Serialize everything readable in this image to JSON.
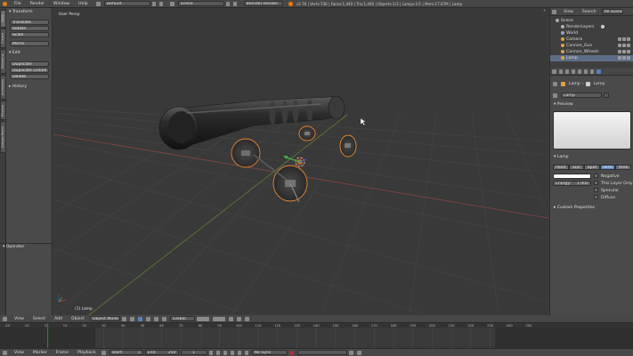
{
  "colors": {
    "accent": "#5680c2",
    "selection_orange": "#e8892c",
    "grid": "#4a4a4a",
    "axis_x": "#9a4b4b",
    "axis_y": "#6b8f3e",
    "current_frame": "#2f7d31"
  },
  "top_bar": {
    "menu": [
      "File",
      "Render",
      "Window",
      "Help"
    ],
    "layout": "Default",
    "scene": "Scene",
    "engine": "Blender Render",
    "stats": "v2.76 | Verts:736 | Faces:1,440 | Tris:1,440 | Objects:1/3 | Lamps:1/1 | Mem:17.67M | Lamp"
  },
  "toolshelf": {
    "tabs": [
      "Tools",
      "Create",
      "Relations",
      "Animation",
      "Physics",
      "Grease Pencil"
    ],
    "transform": {
      "title": "Transform",
      "buttons": [
        "Translate",
        "Rotate",
        "Scale",
        "Mirror"
      ]
    },
    "edit": {
      "title": "Edit",
      "buttons": [
        "Duplicate",
        "Duplicate Linked",
        "Delete"
      ]
    },
    "history": {
      "title": "History"
    },
    "operator": {
      "title": "Operator"
    }
  },
  "viewport": {
    "view_label": "User Persp",
    "object_label": "(1) Lamp"
  },
  "view3d_header": {
    "menus": [
      "View",
      "Select",
      "Add",
      "Object"
    ],
    "mode": "Object Mode",
    "pivot": "Global"
  },
  "outliner": {
    "header_menus": [
      "View",
      "Search"
    ],
    "filter": "All Scenes",
    "items": [
      {
        "label": "Scene",
        "indent": 0,
        "selected": false,
        "icon_color": "#a8a8a8"
      },
      {
        "label": "RenderLayers",
        "indent": 1,
        "selected": false,
        "icon_color": "#b0b0b0"
      },
      {
        "label": "World",
        "indent": 1,
        "selected": false,
        "icon_color": "#8fa6c8"
      },
      {
        "label": "Camera",
        "indent": 1,
        "selected": false,
        "icon_color": "#e0a040"
      },
      {
        "label": "Cannon_Gun",
        "indent": 1,
        "selected": false,
        "icon_color": "#e0a040"
      },
      {
        "label": "Cannon_Wheels",
        "indent": 1,
        "selected": false,
        "icon_color": "#e0a040"
      },
      {
        "label": "Lamp",
        "indent": 1,
        "selected": true,
        "icon_color": "#e0a040"
      }
    ]
  },
  "properties": {
    "breadcrumb": [
      "Lamp",
      "Lamp"
    ],
    "datablock": "Lamp",
    "preview": {
      "title": "Preview"
    },
    "lamp": {
      "title": "Lamp",
      "types": [
        "Point",
        "Sun",
        "Spot",
        "Hemi",
        "Area"
      ],
      "active_type": "Hemi",
      "energy_label": "Energy:",
      "energy_value": "1.000",
      "options": [
        "Negative",
        "This Layer Only",
        "Specular",
        "Diffuse"
      ]
    },
    "custom": {
      "title": "Custom Properties"
    }
  },
  "timeline": {
    "ticks": [
      "-20",
      "-10",
      "0",
      "10",
      "20",
      "30",
      "40",
      "50",
      "60",
      "70",
      "80",
      "90",
      "100",
      "110",
      "120",
      "130",
      "140",
      "150",
      "160",
      "170",
      "180",
      "190",
      "200",
      "210",
      "220",
      "230",
      "240",
      "250"
    ],
    "current_frame": 1,
    "footer_menus": [
      "View",
      "Marker",
      "Frame",
      "Playback"
    ],
    "start_label": "Start:",
    "start_value": "1",
    "end_label": "End:",
    "end_value": "250",
    "frame_value": "1",
    "sync": "No Sync"
  }
}
